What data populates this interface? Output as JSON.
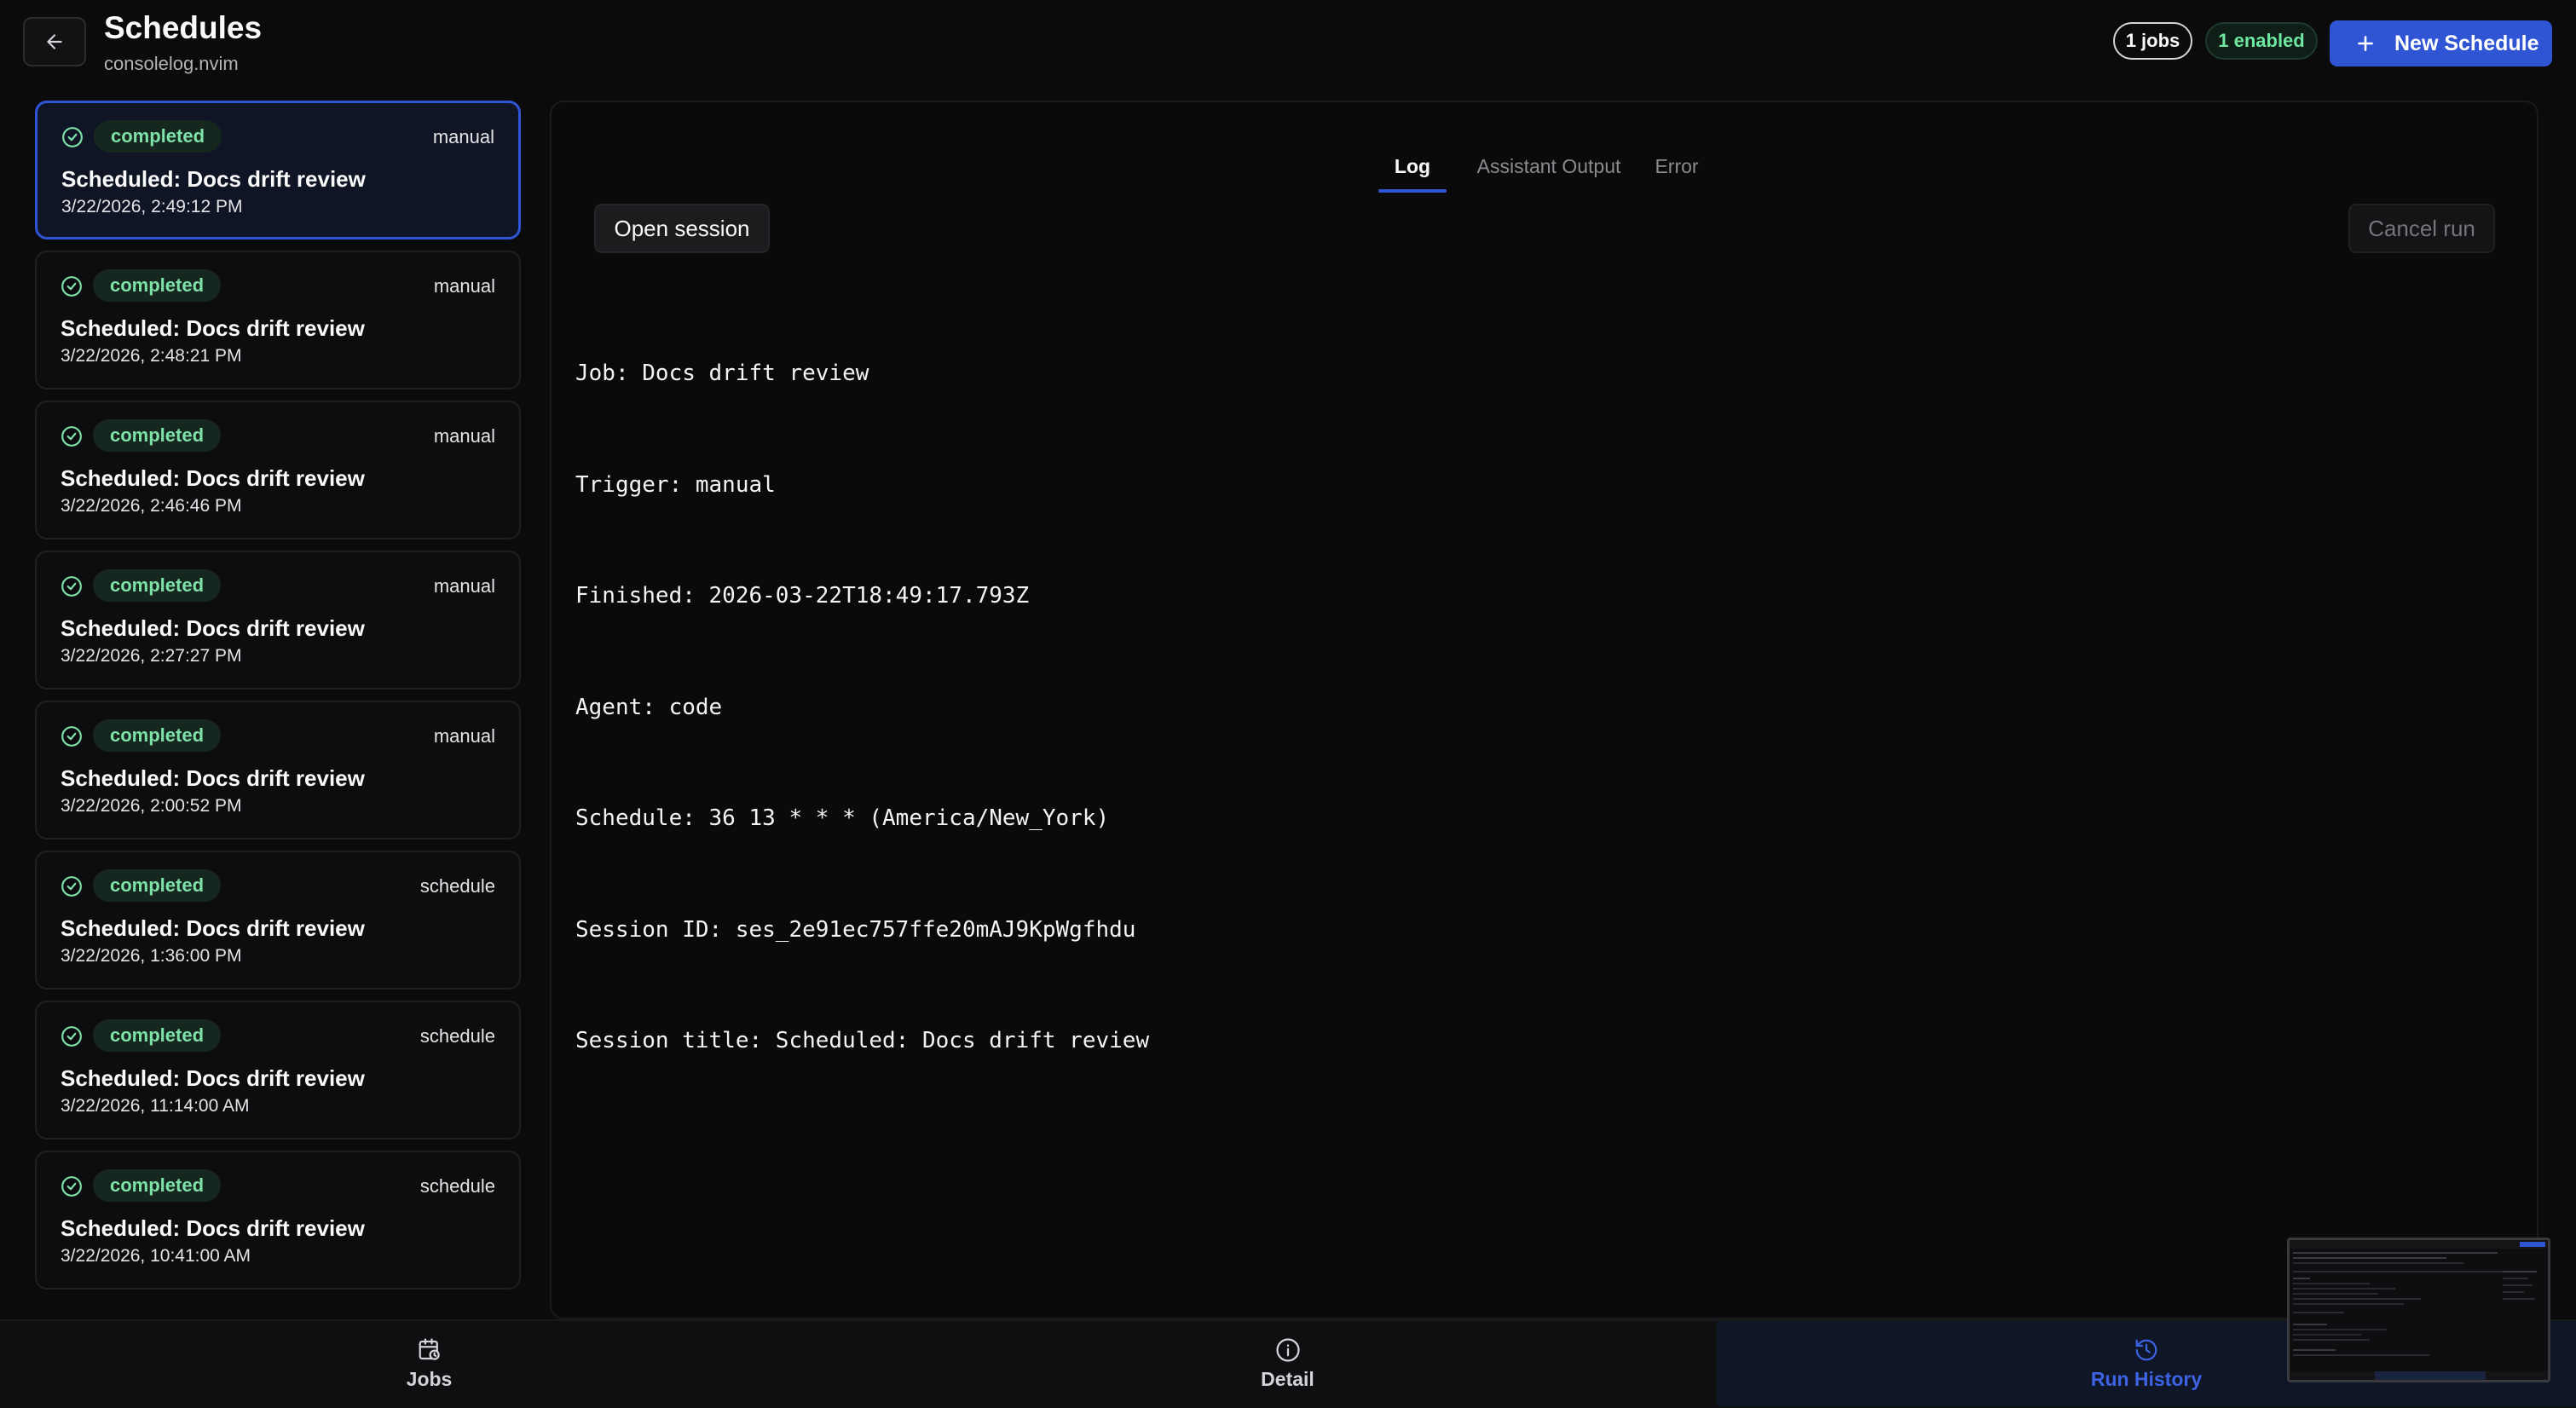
{
  "header": {
    "title": "Schedules",
    "subtitle": "consolelog.nvim",
    "jobs_count": "1 jobs",
    "enabled_count": "1 enabled",
    "new_schedule_label": "New Schedule"
  },
  "runs": [
    {
      "status": "completed",
      "trigger": "manual",
      "title": "Scheduled: Docs drift review",
      "time": "3/22/2026, 2:49:12 PM"
    },
    {
      "status": "completed",
      "trigger": "manual",
      "title": "Scheduled: Docs drift review",
      "time": "3/22/2026, 2:48:21 PM"
    },
    {
      "status": "completed",
      "trigger": "manual",
      "title": "Scheduled: Docs drift review",
      "time": "3/22/2026, 2:46:46 PM"
    },
    {
      "status": "completed",
      "trigger": "manual",
      "title": "Scheduled: Docs drift review",
      "time": "3/22/2026, 2:27:27 PM"
    },
    {
      "status": "completed",
      "trigger": "manual",
      "title": "Scheduled: Docs drift review",
      "time": "3/22/2026, 2:00:52 PM"
    },
    {
      "status": "completed",
      "trigger": "schedule",
      "title": "Scheduled: Docs drift review",
      "time": "3/22/2026, 1:36:00 PM"
    },
    {
      "status": "completed",
      "trigger": "schedule",
      "title": "Scheduled: Docs drift review",
      "time": "3/22/2026, 11:14:00 AM"
    },
    {
      "status": "completed",
      "trigger": "schedule",
      "title": "Scheduled: Docs drift review",
      "time": "3/22/2026, 10:41:00 AM"
    }
  ],
  "detail": {
    "tabs": [
      "Log",
      "Assistant Output",
      "Error"
    ],
    "active_tab": "Log",
    "open_session_label": "Open session",
    "cancel_run_label": "Cancel run",
    "log_lines": [
      "Job: Docs drift review",
      "Trigger: manual",
      "Finished: 2026-03-22T18:49:17.793Z",
      "Agent: code",
      "Schedule: 36 13 * * * (America/New_York)",
      "Session ID: ses_2e91ec757ffe20mAJ9KpWgfhdu",
      "Session title: Scheduled: Docs drift review"
    ]
  },
  "nav": {
    "jobs_label": "Jobs",
    "detail_label": "Detail",
    "history_label": "Run History",
    "active": "Run History"
  },
  "colors": {
    "accent": "#2f55d4",
    "status_green": "#7ee2a8",
    "background": "#0b0b0c"
  },
  "icons": {
    "back": "arrow-left-icon",
    "plus": "plus-icon",
    "status": "check-circle-icon",
    "jobs": "calendar-clock-icon",
    "detail": "info-icon",
    "history": "history-icon"
  }
}
